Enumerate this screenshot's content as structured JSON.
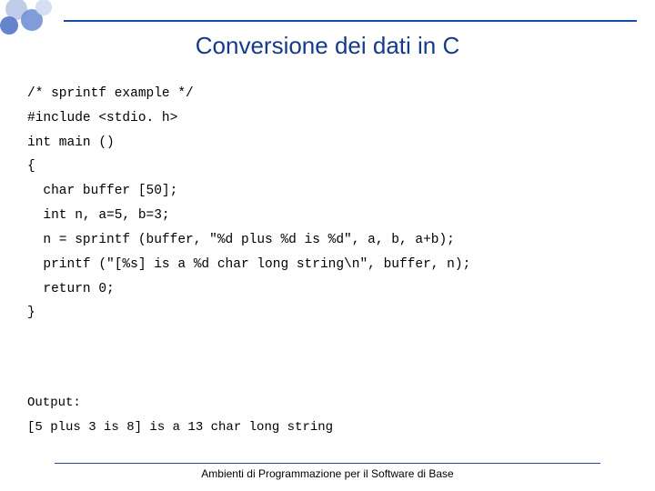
{
  "title": "Conversione dei dati in C",
  "code": "/* sprintf example */\n#include <stdio. h>\nint main ()\n{\n  char buffer [50];\n  int n, a=5, b=3;\n  n = sprintf (buffer, \"%d plus %d is %d\", a, b, a+b);\n  printf (\"[%s] is a %d char long string\\n\", buffer, n);\n  return 0;\n}",
  "output_label": "Output:",
  "output_text": "[5 plus 3 is 8] is a 13 char long string",
  "footer": "Ambienti di Programmazione per il Software di Base"
}
